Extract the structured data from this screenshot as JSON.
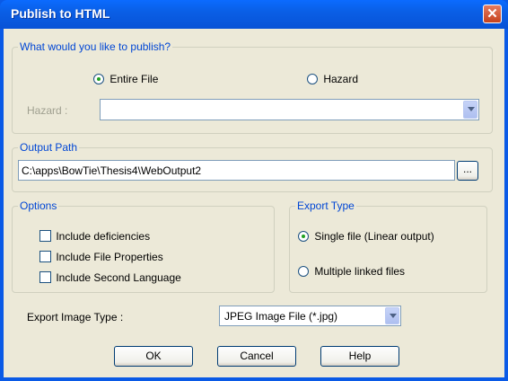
{
  "window": {
    "title": "Publish to HTML",
    "close_glyph": "✕"
  },
  "publish": {
    "legend": "What would you like to publish?",
    "entire_file_label": "Entire File",
    "hazard_option_label": "Hazard",
    "selected": "Entire File",
    "hazard_field_label": "Hazard :",
    "hazard_value": ""
  },
  "output": {
    "legend": "Output Path",
    "path_value": "C:\\apps\\BowTie\\Thesis4\\WebOutput2",
    "browse_label": "..."
  },
  "options": {
    "legend": "Options",
    "items": [
      {
        "label": "Include deficiencies",
        "checked": false
      },
      {
        "label": "Include File Properties",
        "checked": false
      },
      {
        "label": "Include Second Language",
        "checked": false
      }
    ]
  },
  "export_type": {
    "legend": "Export Type",
    "single_label": "Single file (Linear output)",
    "multiple_label": "Multiple linked files",
    "selected": "Single file (Linear output)"
  },
  "image_type": {
    "label": "Export Image Type :",
    "value": "JPEG Image File (*.jpg)"
  },
  "buttons": {
    "ok": "OK",
    "cancel": "Cancel",
    "help": "Help"
  }
}
